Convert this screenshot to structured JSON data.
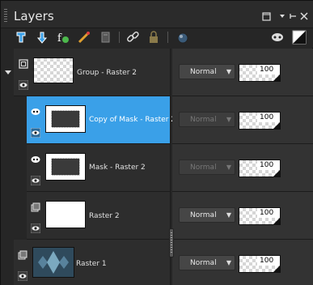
{
  "window": {
    "title": "Layers"
  },
  "title_buttons": [
    {
      "name": "restore-icon",
      "glyph": "▢"
    },
    {
      "name": "menu-arrow-icon",
      "glyph": "▾"
    },
    {
      "name": "pin-icon",
      "glyph": "⊣"
    },
    {
      "name": "close-icon",
      "glyph": "✕"
    }
  ],
  "toolbar": {
    "tools": [
      "new-raster-layer-icon",
      "new-vector-layer-icon",
      "new-adjustment-layer-icon",
      "layer-properties-icon",
      "delete-layer-icon",
      "link-icon",
      "lock-icon",
      "render-icon",
      "mask-visibility-icon",
      "highlight-icon"
    ]
  },
  "layers": [
    {
      "name": "Group - Raster 2",
      "blend": "Normal",
      "opacity": "100",
      "kind": "group",
      "selected": false,
      "blend_enabled": true
    },
    {
      "name": "Copy of Mask - Raster 2",
      "blend": "Normal",
      "opacity": "100",
      "kind": "mask",
      "selected": true,
      "blend_enabled": false
    },
    {
      "name": "Mask - Raster 2",
      "blend": "Normal",
      "opacity": "100",
      "kind": "mask",
      "selected": false,
      "blend_enabled": false
    },
    {
      "name": "Raster 2",
      "blend": "Normal",
      "opacity": "100",
      "kind": "raster-white",
      "selected": false,
      "blend_enabled": true
    },
    {
      "name": "Raster 1",
      "blend": "Normal",
      "opacity": "100",
      "kind": "raster-image",
      "selected": false,
      "blend_enabled": true
    }
  ],
  "colors": {
    "accent": "#3aa0e8",
    "panel": "#262626"
  }
}
